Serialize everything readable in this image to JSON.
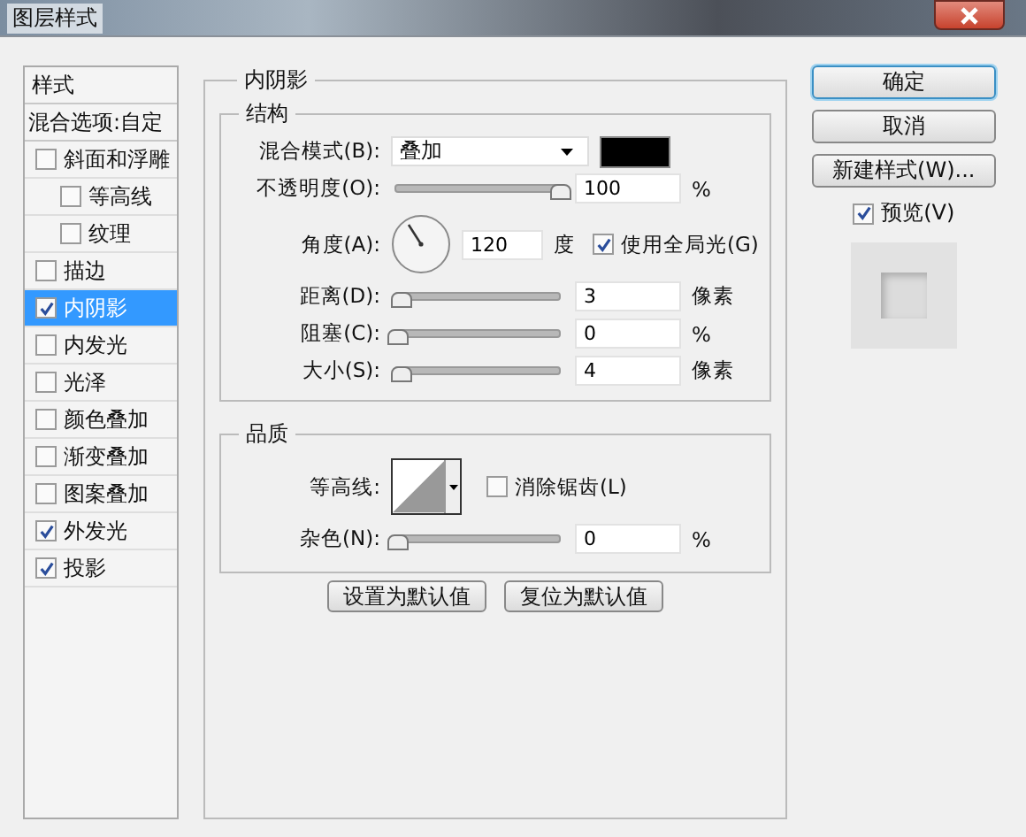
{
  "window": {
    "title": "图层样式"
  },
  "sidebar": {
    "header": "样式",
    "blend_options": "混合选项:自定",
    "items": [
      {
        "label": "斜面和浮雕",
        "checked": false,
        "selected": false,
        "children": [
          {
            "label": "等高线",
            "checked": false,
            "selected": false
          },
          {
            "label": "纹理",
            "checked": false,
            "selected": false
          }
        ]
      },
      {
        "label": "描边",
        "checked": false,
        "selected": false
      },
      {
        "label": "内阴影",
        "checked": true,
        "selected": true
      },
      {
        "label": "内发光",
        "checked": false,
        "selected": false
      },
      {
        "label": "光泽",
        "checked": false,
        "selected": false
      },
      {
        "label": "颜色叠加",
        "checked": false,
        "selected": false
      },
      {
        "label": "渐变叠加",
        "checked": false,
        "selected": false
      },
      {
        "label": "图案叠加",
        "checked": false,
        "selected": false
      },
      {
        "label": "外发光",
        "checked": true,
        "selected": false
      },
      {
        "label": "投影",
        "checked": true,
        "selected": false
      }
    ]
  },
  "panel": {
    "title": "内阴影",
    "structure": {
      "title": "结构",
      "blend_mode": {
        "label": "混合模式(B):",
        "value": "叠加",
        "color": "#000000"
      },
      "opacity": {
        "label": "不透明度(O):",
        "level": 1,
        "value": "100",
        "unit": "%"
      },
      "angle": {
        "label": "角度(A):",
        "value": "120",
        "unit": "度",
        "global_light": {
          "label": "使用全局光(G)",
          "checked": true
        }
      },
      "sliders": [
        {
          "label": "距离(D):",
          "level": 0.02,
          "value": "3",
          "unit": "像素"
        },
        {
          "label": "阻塞(C):",
          "level": 0,
          "value": "0",
          "unit": "%"
        },
        {
          "label": "大小(S):",
          "level": 0.02,
          "value": "4",
          "unit": "像素"
        }
      ]
    },
    "quality": {
      "title": "品质",
      "contour_label": "等高线:",
      "anti_alias": {
        "label": "消除锯齿(L)",
        "checked": false
      },
      "noise": {
        "label": "杂色(N):",
        "level": 0,
        "value": "0",
        "unit": "%"
      }
    },
    "buttons": [
      "设置为默认值",
      "复位为默认值"
    ]
  },
  "actions": [
    {
      "label": "确定",
      "default": true
    },
    {
      "label": "取消",
      "default": false
    },
    {
      "label": "新建样式(W)...",
      "default": false
    }
  ],
  "preview": {
    "label": "预览(V)",
    "checked": true
  }
}
